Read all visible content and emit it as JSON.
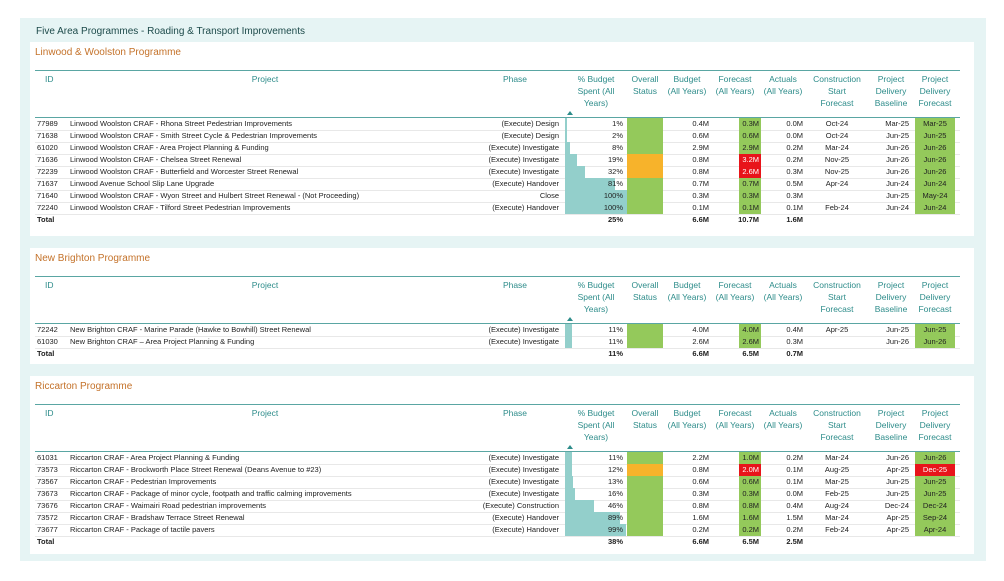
{
  "page_title": "Five Area Programmes - Roading & Transport Improvements",
  "colors": {
    "green": "#94c95b",
    "amber": "#f7b32b",
    "red": "#e8141a",
    "bar": "#93cfcb",
    "accent": "#2d8c8a",
    "title": "#c4722a"
  },
  "headers": {
    "id": "ID",
    "project": "Project",
    "phase": "Phase",
    "pct": [
      "% Budget",
      "Spent (All",
      "Years)"
    ],
    "status": [
      "Overall",
      "Status"
    ],
    "budget": [
      "Budget",
      "(All Years)"
    ],
    "forecast": [
      "Forecast",
      "(All Years)"
    ],
    "actuals": [
      "Actuals",
      "(All Years)"
    ],
    "csf": [
      "Construction",
      "Start",
      "Forecast"
    ],
    "pdb": [
      "Project",
      "Delivery",
      "Baseline"
    ],
    "pdf": [
      "Project",
      "Delivery",
      "Forecast"
    ]
  },
  "programmes": [
    {
      "title": "Linwood & Woolston Programme",
      "rows": [
        {
          "id": "77989",
          "project": "Linwood Woolston CRAF - Rhona Street Pedestrian Improvements",
          "phase": "(Execute) Design",
          "pct": "1%",
          "pct_value": 1,
          "status": "green",
          "budget": "0.4M",
          "forecast": "0.3M",
          "forecast_color": "green",
          "actuals": "0.0M",
          "csf": "Oct-24",
          "pdb": "Mar-25",
          "pdf": "Mar-25",
          "pdf_color": "green"
        },
        {
          "id": "71638",
          "project": "Linwood Woolston CRAF - Smith Street Cycle & Pedestrian Improvements",
          "phase": "(Execute) Design",
          "pct": "2%",
          "pct_value": 2,
          "status": "green",
          "budget": "0.6M",
          "forecast": "0.6M",
          "forecast_color": "green",
          "actuals": "0.0M",
          "csf": "Oct-24",
          "pdb": "Jun-25",
          "pdf": "Jun-25",
          "pdf_color": "green"
        },
        {
          "id": "61020",
          "project": "Linwood Woolston CRAF - Area Project Planning & Funding",
          "phase": "(Execute) Investigate",
          "pct": "8%",
          "pct_value": 8,
          "status": "green",
          "budget": "2.9M",
          "forecast": "2.9M",
          "forecast_color": "green",
          "actuals": "0.2M",
          "csf": "Mar-24",
          "pdb": "Jun-26",
          "pdf": "Jun-26",
          "pdf_color": "green"
        },
        {
          "id": "71636",
          "project": "Linwood Woolston CRAF - Chelsea Street Renewal",
          "phase": "(Execute) Investigate",
          "pct": "19%",
          "pct_value": 19,
          "status": "amber",
          "budget": "0.8M",
          "forecast": "3.2M",
          "forecast_color": "red",
          "actuals": "0.2M",
          "csf": "Nov-25",
          "pdb": "Jun-26",
          "pdf": "Jun-26",
          "pdf_color": "green"
        },
        {
          "id": "72239",
          "project": "Linwood Woolston CRAF - Butterfield and Worcester Street Renewal",
          "phase": "(Execute) Investigate",
          "pct": "32%",
          "pct_value": 32,
          "status": "amber",
          "budget": "0.8M",
          "forecast": "2.6M",
          "forecast_color": "red",
          "actuals": "0.3M",
          "csf": "Nov-25",
          "pdb": "Jun-26",
          "pdf": "Jun-26",
          "pdf_color": "green"
        },
        {
          "id": "71637",
          "project": "Linwood Avenue School Slip Lane Upgrade",
          "phase": "(Execute) Handover",
          "pct": "81%",
          "pct_value": 81,
          "status": "green",
          "budget": "0.7M",
          "forecast": "0.7M",
          "forecast_color": "green",
          "actuals": "0.5M",
          "csf": "Apr-24",
          "pdb": "Jun-24",
          "pdf": "Jun-24",
          "pdf_color": "green"
        },
        {
          "id": "71640",
          "project": "Linwood Woolston CRAF - Wyon Street and Hulbert Street Renewal - (Not Proceeding)",
          "phase": "Close",
          "pct": "100%",
          "pct_value": 100,
          "status": "green",
          "budget": "0.3M",
          "forecast": "0.3M",
          "forecast_color": "green",
          "actuals": "0.3M",
          "csf": "",
          "pdb": "Jun-25",
          "pdf": "May-24",
          "pdf_color": "green"
        },
        {
          "id": "72240",
          "project": "Linwood Woolston CRAF - Tilford Street Pedestrian Improvements",
          "phase": "(Execute) Handover",
          "pct": "100%",
          "pct_value": 100,
          "status": "green",
          "budget": "0.1M",
          "forecast": "0.1M",
          "forecast_color": "green",
          "actuals": "0.1M",
          "csf": "Feb-24",
          "pdb": "Jun-24",
          "pdf": "Jun-24",
          "pdf_color": "green"
        }
      ],
      "total": {
        "label": "Total",
        "pct": "25%",
        "budget": "6.6M",
        "forecast": "10.7M",
        "actuals": "1.6M"
      }
    },
    {
      "title": "New Brighton Programme",
      "rows": [
        {
          "id": "72242",
          "project": "New Brighton CRAF - Marine Parade (Hawke to Bowhill) Street Renewal",
          "phase": "(Execute) Investigate",
          "pct": "11%",
          "pct_value": 11,
          "status": "green",
          "budget": "4.0M",
          "forecast": "4.0M",
          "forecast_color": "green",
          "actuals": "0.4M",
          "csf": "Apr-25",
          "pdb": "Jun-25",
          "pdf": "Jun-25",
          "pdf_color": "green"
        },
        {
          "id": "61030",
          "project": "New Brighton CRAF – Area Project Planning & Funding",
          "phase": "(Execute) Investigate",
          "pct": "11%",
          "pct_value": 11,
          "status": "green",
          "budget": "2.6M",
          "forecast": "2.6M",
          "forecast_color": "green",
          "actuals": "0.3M",
          "csf": "",
          "pdb": "Jun-26",
          "pdf": "Jun-26",
          "pdf_color": "green"
        }
      ],
      "total": {
        "label": "Total",
        "pct": "11%",
        "budget": "6.6M",
        "forecast": "6.5M",
        "actuals": "0.7M"
      }
    },
    {
      "title": "Riccarton Programme",
      "rows": [
        {
          "id": "61031",
          "project": "Riccarton CRAF - Area Project Planning & Funding",
          "phase": "(Execute) Investigate",
          "pct": "11%",
          "pct_value": 11,
          "status": "green",
          "budget": "2.2M",
          "forecast": "1.0M",
          "forecast_color": "green",
          "actuals": "0.2M",
          "csf": "Mar-24",
          "pdb": "Jun-26",
          "pdf": "Jun-26",
          "pdf_color": "green"
        },
        {
          "id": "73573",
          "project": "Riccarton CRAF - Brockworth Place Street Renewal (Deans Avenue to #23)",
          "phase": "(Execute) Investigate",
          "pct": "12%",
          "pct_value": 12,
          "status": "amber",
          "budget": "0.8M",
          "forecast": "2.0M",
          "forecast_color": "red",
          "actuals": "0.1M",
          "csf": "Aug-25",
          "pdb": "Apr-25",
          "pdf": "Dec-25",
          "pdf_color": "red"
        },
        {
          "id": "73567",
          "project": "Riccarton CRAF - Pedestrian Improvements",
          "phase": "(Execute) Investigate",
          "pct": "13%",
          "pct_value": 13,
          "status": "green",
          "budget": "0.6M",
          "forecast": "0.6M",
          "forecast_color": "green",
          "actuals": "0.1M",
          "csf": "Mar-25",
          "pdb": "Jun-25",
          "pdf": "Jun-25",
          "pdf_color": "green"
        },
        {
          "id": "73673",
          "project": "Riccarton CRAF - Package of minor cycle, footpath and traffic calming improvements",
          "phase": "(Execute) Investigate",
          "pct": "16%",
          "pct_value": 16,
          "status": "green",
          "budget": "0.3M",
          "forecast": "0.3M",
          "forecast_color": "green",
          "actuals": "0.0M",
          "csf": "Feb-25",
          "pdb": "Jun-25",
          "pdf": "Jun-25",
          "pdf_color": "green"
        },
        {
          "id": "73676",
          "project": "Riccarton CRAF - Waimairi Road pedestrian improvements",
          "phase": "(Execute) Construction",
          "pct": "46%",
          "pct_value": 46,
          "status": "green",
          "budget": "0.8M",
          "forecast": "0.8M",
          "forecast_color": "green",
          "actuals": "0.4M",
          "csf": "Aug-24",
          "pdb": "Dec-24",
          "pdf": "Dec-24",
          "pdf_color": "green"
        },
        {
          "id": "73572",
          "project": "Riccarton CRAF - Bradshaw Terrace Street Renewal",
          "phase": "(Execute) Handover",
          "pct": "89%",
          "pct_value": 89,
          "status": "green",
          "budget": "1.6M",
          "forecast": "1.6M",
          "forecast_color": "green",
          "actuals": "1.5M",
          "csf": "Mar-24",
          "pdb": "Apr-25",
          "pdf": "Sep-24",
          "pdf_color": "green"
        },
        {
          "id": "73677",
          "project": "Riccarton CRAF - Package of tactile pavers",
          "phase": "(Execute) Handover",
          "pct": "99%",
          "pct_value": 99,
          "status": "green",
          "budget": "0.2M",
          "forecast": "0.2M",
          "forecast_color": "green",
          "actuals": "0.2M",
          "csf": "Feb-24",
          "pdb": "Apr-25",
          "pdf": "Apr-24",
          "pdf_color": "green"
        }
      ],
      "total": {
        "label": "Total",
        "pct": "38%",
        "budget": "6.6M",
        "forecast": "6.5M",
        "actuals": "2.5M"
      }
    }
  ]
}
